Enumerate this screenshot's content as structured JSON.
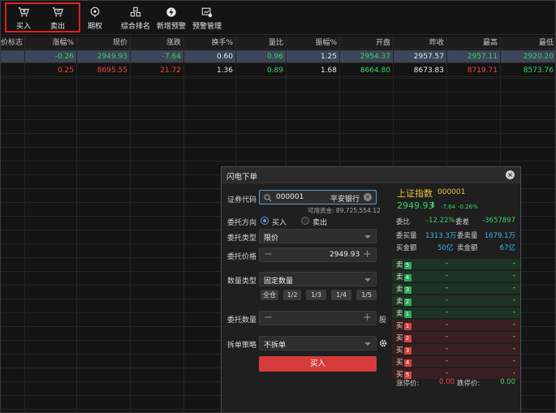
{
  "toolbar": {
    "buy": "买入",
    "sell": "卖出",
    "options": "期权",
    "ranking": "综合排名",
    "new_alert": "新增预警",
    "alert_manage": "预警管理"
  },
  "table": {
    "headers": [
      "价标志",
      "涨幅%",
      "现价",
      "涨跌",
      "换手%",
      "量比",
      "振幅%",
      "开盘",
      "昨收",
      "最高",
      "最低"
    ],
    "rows": [
      {
        "cells": [
          "",
          "-0.26",
          "2949.93",
          "-7.64",
          "0.60",
          "0.96",
          "1.25",
          "2954.37",
          "2957.57",
          "2957.11",
          "2920.20"
        ],
        "colors": [
          "wh",
          "dn",
          "dn",
          "dn",
          "wh",
          "dn",
          "wh",
          "dn",
          "wh",
          "dn",
          "dn"
        ]
      },
      {
        "cells": [
          "",
          "0.25",
          "8695.55",
          "21.72",
          "1.36",
          "0.89",
          "1.68",
          "8664.80",
          "8673.83",
          "8719.71",
          "8573.76"
        ],
        "colors": [
          "wh",
          "up",
          "up",
          "up",
          "wh",
          "dn",
          "wh",
          "dn",
          "wh",
          "up",
          "dn"
        ]
      }
    ]
  },
  "dialog": {
    "title": "闪电下单",
    "security_code_label": "证券代码",
    "security_code_value": "000001",
    "security_name": "平安银行",
    "available_funds": "可用资金: 89,725,554.12",
    "direction_label": "委托方向",
    "direction_buy": "买入",
    "direction_sell": "卖出",
    "order_type_label": "委托类型",
    "order_type_value": "限价",
    "price_label": "委托价格",
    "price_value": "2949.93",
    "qty_type_label": "数量类型",
    "qty_type_value": "固定数量",
    "qty_buttons": [
      "全仓",
      "1/2",
      "1/3",
      "1/4",
      "1/5"
    ],
    "qty_label": "委托数量",
    "qty_unit": "股",
    "split_label": "拆单策略",
    "split_value": "不拆单",
    "submit": "买入"
  },
  "quote": {
    "name": "上证指数",
    "code": "000001",
    "price": "2949.93",
    "arrow": "⬇",
    "change": "-7.64",
    "change_pct": "-0.26%",
    "weibi_label": "委比",
    "weibi_value": "-12.22%",
    "weicha_label": "委差",
    "weicha_value": "-3657897",
    "weimai_label": "委买量",
    "weimai_value": "1313.3万",
    "weimaii_label": "委卖量",
    "weimaii_value": "1679.1万",
    "buy_amt_label": "买金额",
    "buy_amt_value": "50亿",
    "sell_amt_label": "卖金额",
    "sell_amt_value": "67亿",
    "sells": [
      {
        "label": "卖",
        "num": "5",
        "price": "-",
        "vol": "-"
      },
      {
        "label": "卖",
        "num": "4",
        "price": "-",
        "vol": "-"
      },
      {
        "label": "卖",
        "num": "3",
        "price": "-",
        "vol": "-"
      },
      {
        "label": "卖",
        "num": "2",
        "price": "-",
        "vol": "-"
      },
      {
        "label": "卖",
        "num": "1",
        "price": "-",
        "vol": "-"
      }
    ],
    "buys": [
      {
        "label": "买",
        "num": "1",
        "price": "-",
        "vol": "-"
      },
      {
        "label": "买",
        "num": "2",
        "price": "-",
        "vol": "-"
      },
      {
        "label": "买",
        "num": "3",
        "price": "-",
        "vol": "-"
      },
      {
        "label": "买",
        "num": "4",
        "price": "-",
        "vol": "-"
      },
      {
        "label": "买",
        "num": "5",
        "price": "-",
        "vol": "-"
      }
    ],
    "limit_up_label": "涨停价:",
    "limit_up_value": "0.00",
    "limit_down_label": "跌停价:",
    "limit_down_value": "0.00"
  },
  "colors": {
    "up": "#f24545",
    "down": "#3bd16b",
    "accent": "#5b9ad6",
    "buy_button": "#d63b3b"
  }
}
